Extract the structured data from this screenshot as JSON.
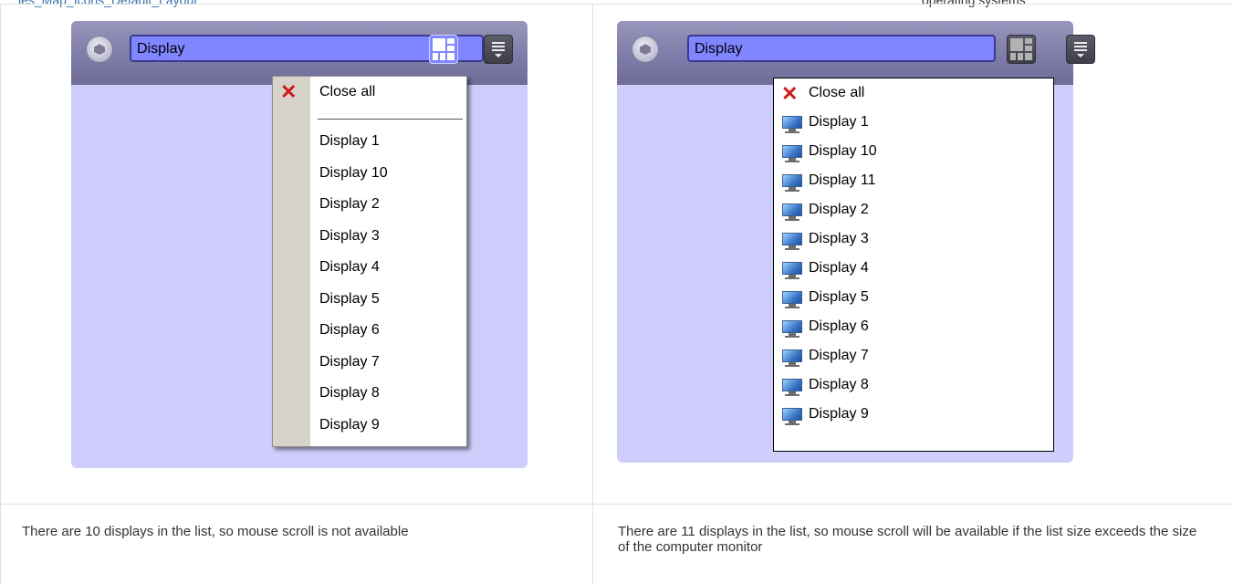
{
  "header": {
    "left_link": "ies_Map_Icons_Default_Layout",
    "right_text": "operating systems"
  },
  "left_panel": {
    "field_value": "Display",
    "menu": {
      "close_all": "Close all",
      "items": [
        "Display 1",
        "Display 10",
        "Display 2",
        "Display 3",
        "Display 4",
        "Display 5",
        "Display 6",
        "Display 7",
        "Display 8",
        "Display 9"
      ]
    },
    "caption": "There are 10 displays in the list, so mouse scroll is not available"
  },
  "right_panel": {
    "field_value": "Display",
    "menu": {
      "close_all": "Close all",
      "items": [
        "Display 1",
        "Display 10",
        "Display 11",
        "Display 2",
        "Display 3",
        "Display 4",
        "Display 5",
        "Display 6",
        "Display 7",
        "Display 8",
        "Display 9"
      ]
    },
    "caption": "There are 11 displays in the list, so mouse scroll will be available if the list size exceeds the size of the computer monitor"
  },
  "icons": {
    "logo": "axxon-logo-icon",
    "layout": "layout-grid-icon",
    "menu": "menu-list-icon",
    "close": "close-x-icon",
    "display": "monitor-icon"
  },
  "colors": {
    "panel_bg": "#cfcdfb",
    "field_bg": "#7f86ff",
    "close_x": "#d01818"
  }
}
